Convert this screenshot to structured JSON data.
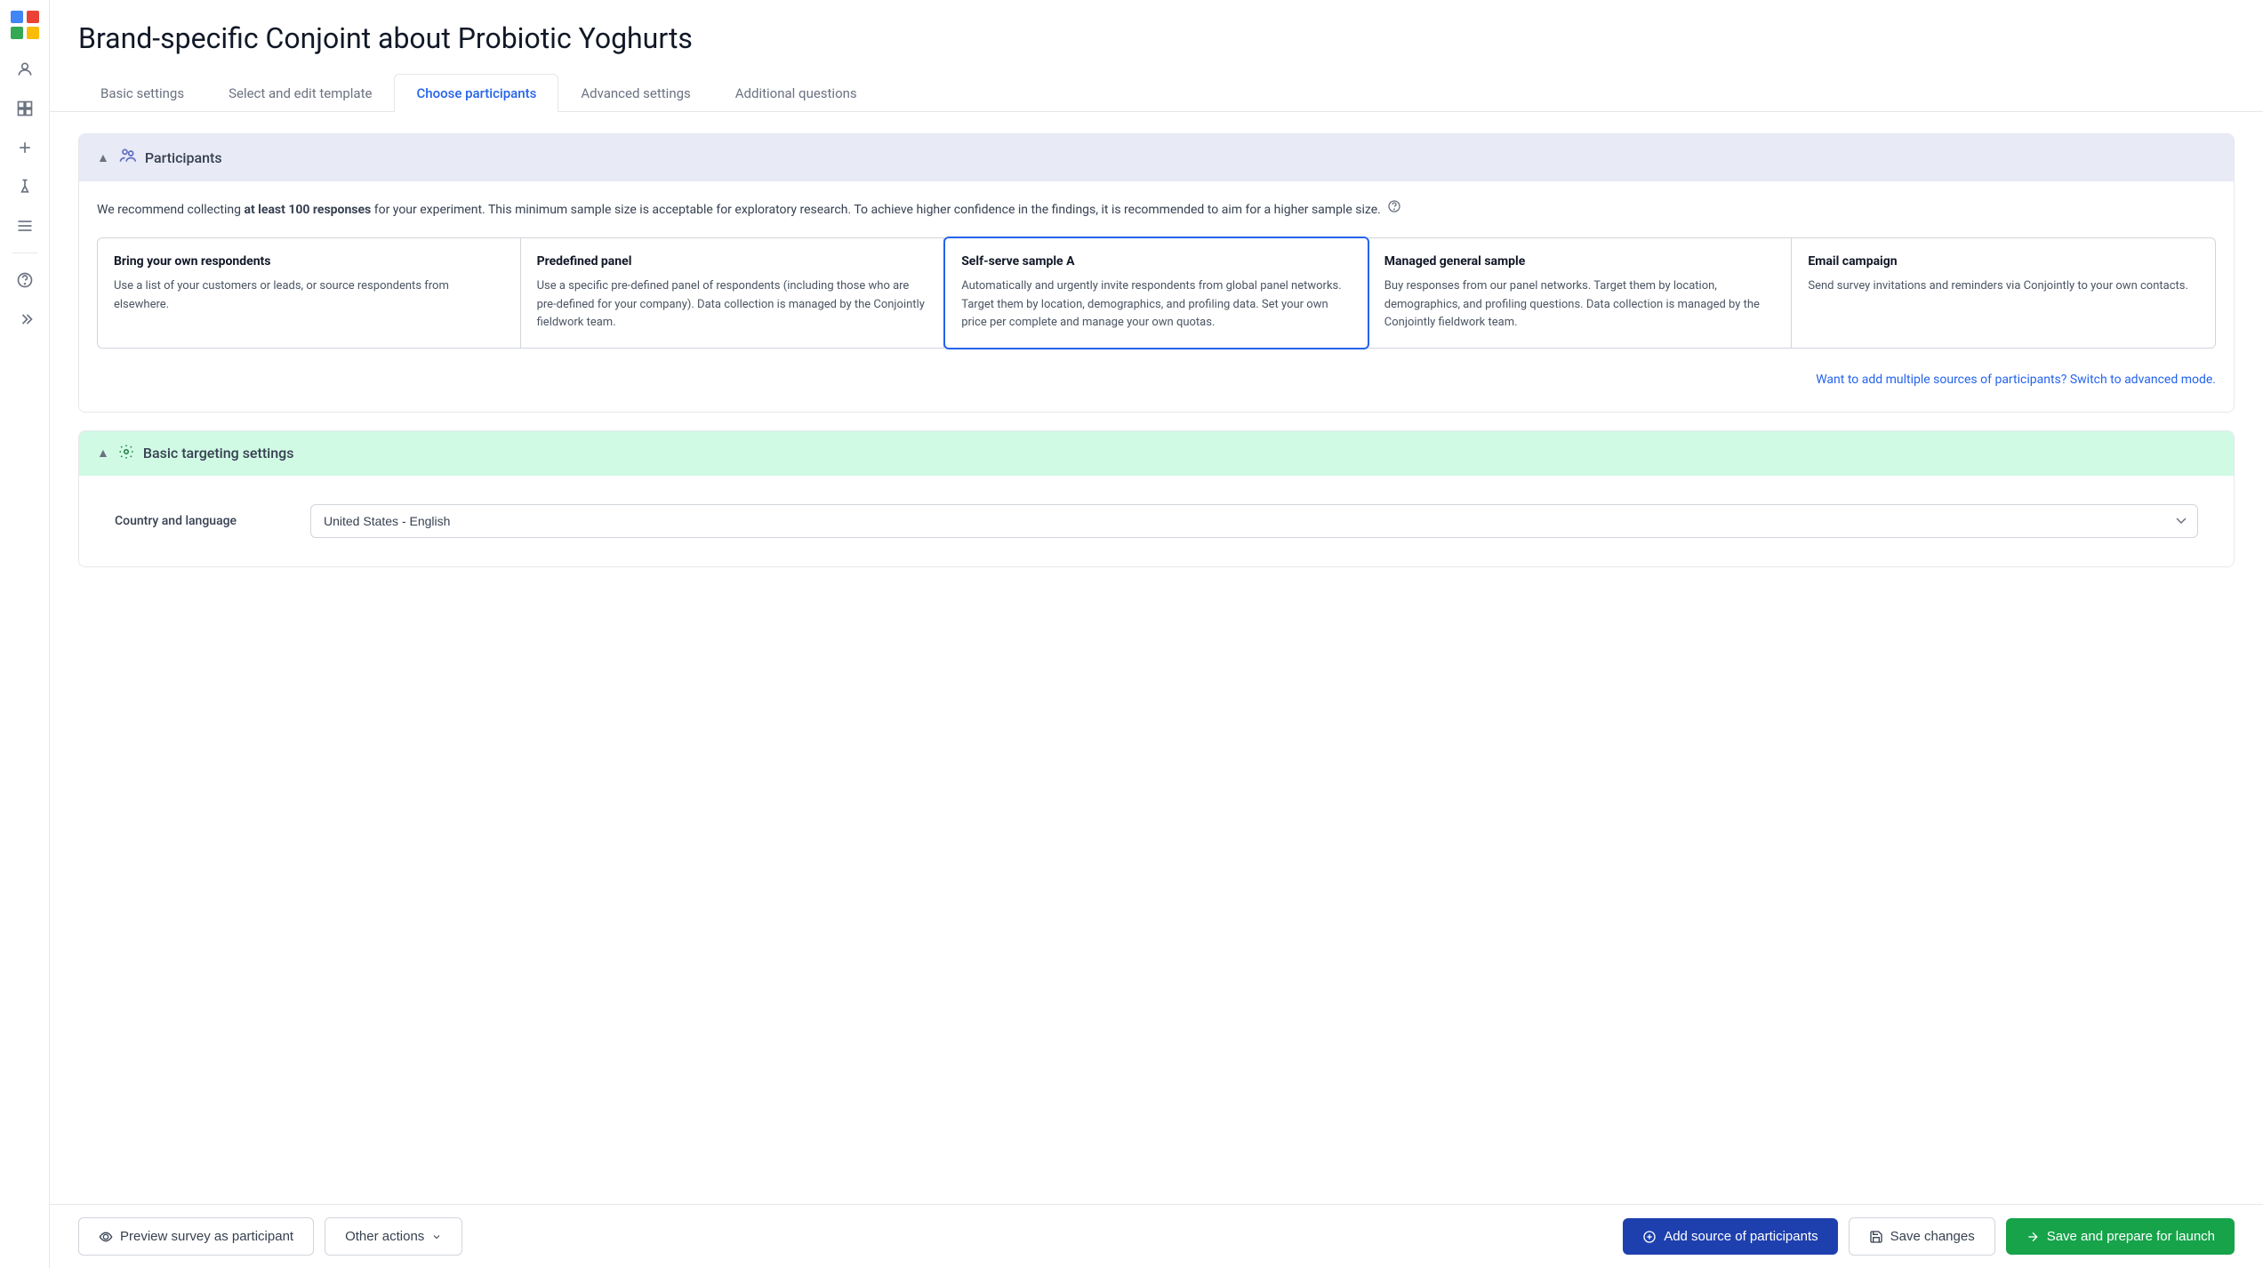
{
  "page": {
    "title": "Brand-specific Conjoint about Probiotic Yoghurts"
  },
  "tabs": [
    {
      "id": "basic",
      "label": "Basic settings",
      "active": false
    },
    {
      "id": "template",
      "label": "Select and edit template",
      "active": false
    },
    {
      "id": "participants",
      "label": "Choose participants",
      "active": true
    },
    {
      "id": "advanced",
      "label": "Advanced settings",
      "active": false
    },
    {
      "id": "questions",
      "label": "Additional questions",
      "active": false
    }
  ],
  "sections": {
    "participants": {
      "title": "Participants",
      "info": "We recommend collecting ",
      "info_bold": "at least 100 responses",
      "info_rest": " for your experiment. This minimum sample size is acceptable for exploratory research. To achieve higher confidence in the findings, it is recommended to aim for a higher sample size.",
      "cards": [
        {
          "id": "own",
          "title": "Bring your own respondents",
          "desc": "Use a list of your customers or leads, or source respondents from elsewhere.",
          "selected": false
        },
        {
          "id": "predefined",
          "title": "Predefined panel",
          "desc": "Use a specific pre-defined panel of respondents (including those who are pre-defined for your company). Data collection is managed by the Conjointly fieldwork team.",
          "selected": false
        },
        {
          "id": "self-serve",
          "title": "Self-serve sample A",
          "desc": "Automatically and urgently invite respondents from global panel networks. Target them by location, demographics, and profiling data. Set your own price per complete and manage your own quotas.",
          "selected": true
        },
        {
          "id": "managed",
          "title": "Managed general sample",
          "desc": "Buy responses from our panel networks. Target them by location, demographics, and profiling questions. Data collection is managed by the Conjointly fieldwork team.",
          "selected": false
        },
        {
          "id": "email",
          "title": "Email campaign",
          "desc": "Send survey invitations and reminders via Conjointly to your own contacts.",
          "selected": false
        }
      ],
      "advanced_link": "Want to add multiple sources of participants? Switch to advanced mode."
    },
    "targeting": {
      "title": "Basic targeting settings",
      "country_label": "Country and language",
      "country_value": "United States - English"
    }
  },
  "bottom_bar": {
    "preview_label": "Preview survey as participant",
    "other_actions_label": "Other actions",
    "add_source_label": "Add source of participants",
    "save_changes_label": "Save changes",
    "save_launch_label": "Save and prepare for launch"
  },
  "sidebar": {
    "icons": [
      {
        "name": "person-icon",
        "glyph": "👤"
      },
      {
        "name": "chart-icon",
        "glyph": "📊"
      },
      {
        "name": "plus-icon",
        "glyph": "+"
      },
      {
        "name": "flask-icon",
        "glyph": "🧪"
      },
      {
        "name": "list-icon",
        "glyph": "☰"
      },
      {
        "name": "target-icon",
        "glyph": "◎"
      },
      {
        "name": "expand-icon",
        "glyph": "»"
      }
    ]
  }
}
